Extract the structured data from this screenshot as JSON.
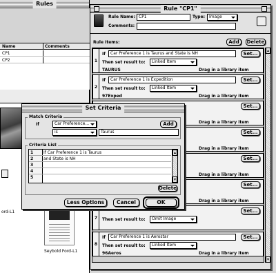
{
  "rules_window": {
    "title": "Rules",
    "columns": [
      "Name",
      "Comments"
    ],
    "rows": [
      {
        "name": "CP1"
      },
      {
        "name": "CP2"
      }
    ]
  },
  "library": {
    "items": [
      {
        "caption": "ord-L1"
      },
      {
        "caption": "Seybold Ford-L1"
      }
    ]
  },
  "rule_window": {
    "title": "Rule \"CP1\"",
    "rule_name_label": "Rule Name:",
    "rule_name_value": "CP1",
    "type_label": "Type:",
    "type_value": "Image",
    "comments_label": "Comments:",
    "comments_value": "",
    "rule_items_label": "Rule Items:",
    "add_label": "Add",
    "delete_label": "Delete",
    "if_label": "If",
    "then_label": "Then set result to:",
    "set_label": "Set...",
    "drag_hint": "Drag in a library item",
    "items": [
      {
        "num": "1",
        "condition": "Car Preference 1 is Taurus and State is NH",
        "result": "Linked Item",
        "library_item": "TAURUS"
      },
      {
        "num": "2",
        "condition": "Car Preference 1 is Expedition",
        "result": "Linked Item",
        "library_item": "97Exped"
      },
      {
        "num": "7",
        "condition": "",
        "result": "Omit Image",
        "library_item": ""
      },
      {
        "num": "8",
        "condition": "Car Preference 1 is Aerostar",
        "result": "Linked Item",
        "library_item": "96Aeros"
      }
    ]
  },
  "dialog": {
    "title": "Set Criteria",
    "match_label": "Match Criteria",
    "if_label": "If",
    "field_value": "Car Preference...",
    "add_label": "Add",
    "operator_value": "is",
    "value": "Taurus",
    "list_label": "Criteria List",
    "criteria": [
      {
        "num": "1",
        "text": "If Car Preference 1 is Taurus"
      },
      {
        "num": "2",
        "text": "and State is NH"
      },
      {
        "num": "3",
        "text": ""
      },
      {
        "num": "4",
        "text": ""
      },
      {
        "num": "5",
        "text": ""
      }
    ],
    "delete_label": "Delete",
    "less_options_label": "Less Options",
    "cancel_label": "Cancel",
    "ok_label": "OK"
  }
}
